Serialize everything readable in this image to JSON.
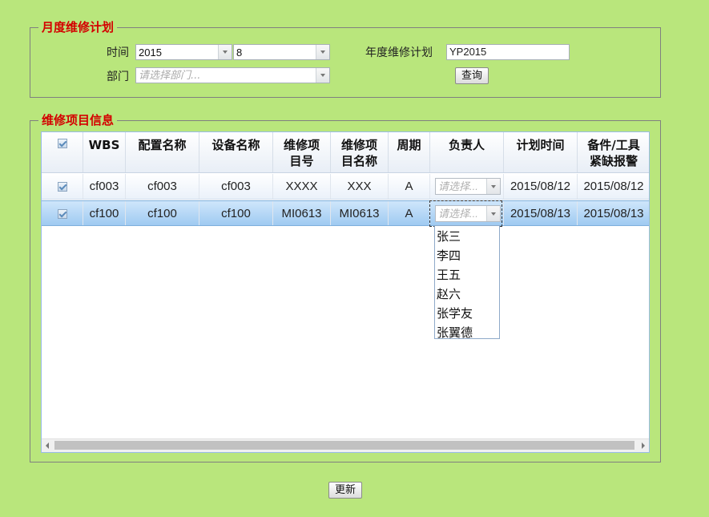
{
  "plan_section": {
    "legend": "月度维修计划",
    "time_label": "时间",
    "year_value": "2015",
    "month_value": "8",
    "dept_label": "部门",
    "dept_placeholder": "请选择部门...",
    "annual_plan_label": "年度维修计划",
    "annual_plan_value": "YP2015",
    "query_button": "查询"
  },
  "items_section": {
    "legend": "维修项目信息",
    "columns": [
      {
        "l1": "WBS",
        "l2": ""
      },
      {
        "l1": "配置名称",
        "l2": ""
      },
      {
        "l1": "设备名称",
        "l2": ""
      },
      {
        "l1": "维修项",
        "l2": "目号"
      },
      {
        "l1": "维修项",
        "l2": "目名称"
      },
      {
        "l1": "周期",
        "l2": ""
      },
      {
        "l1": "负责人",
        "l2": ""
      },
      {
        "l1": "计划时间",
        "l2": ""
      },
      {
        "l1": "备件/工具",
        "l2": "紧缺报警"
      }
    ],
    "rows": [
      {
        "wbs": "cf003",
        "config": "cf003",
        "device": "cf003",
        "item_no": "XXXX",
        "item_name": "XXX",
        "cycle": "A",
        "owner_placeholder": "请选择...",
        "plan_time": "2015/08/12",
        "alert": "2015/08/12"
      },
      {
        "wbs": "cf100",
        "config": "cf100",
        "device": "cf100",
        "item_no": "MI0613",
        "item_name": "MI0613",
        "cycle": "A",
        "owner_placeholder": "请选择...",
        "plan_time": "2015/08/13",
        "alert": "2015/08/13"
      }
    ],
    "owner_options": [
      "张三",
      "李四",
      "王五",
      "赵六",
      "张学友",
      "张翼德"
    ]
  },
  "update_button": "更新"
}
